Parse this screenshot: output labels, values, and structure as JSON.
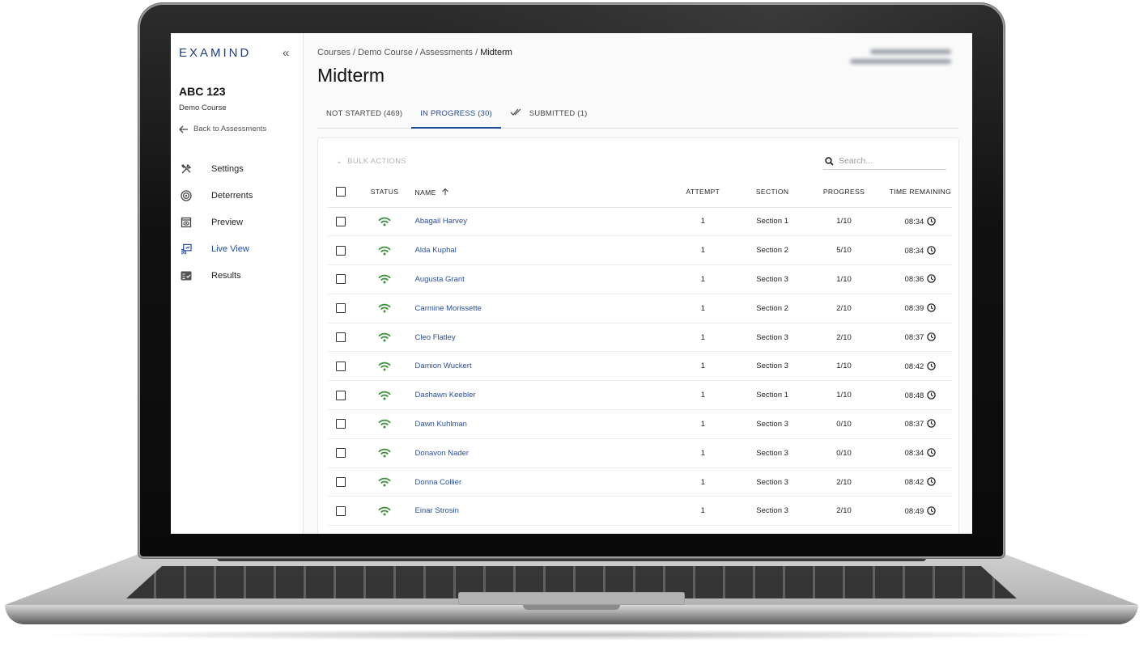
{
  "brand": {
    "logo_text": "EXAMIND",
    "accent": "#1f4a9a",
    "status_ok": "#3a8f3a"
  },
  "sidebar": {
    "collapse_icon": "double-chevron-left-icon",
    "course_code": "ABC 123",
    "course_name": "Demo Course",
    "back_label": "Back to Assessments",
    "items": [
      {
        "label": "Settings",
        "icon": "tools-icon",
        "active": false
      },
      {
        "label": "Deterrents",
        "icon": "target-icon",
        "active": false
      },
      {
        "label": "Preview",
        "icon": "preview-eye-icon",
        "active": false
      },
      {
        "label": "Live View",
        "icon": "live-cast-icon",
        "active": true
      },
      {
        "label": "Results",
        "icon": "results-list-icon",
        "active": false
      }
    ]
  },
  "header": {
    "breadcrumb": [
      "Courses",
      "Demo Course",
      "Assessments",
      "Midterm"
    ],
    "title": "Midterm"
  },
  "tabs": [
    {
      "label": "NOT STARTED (469)",
      "active": false
    },
    {
      "label": "IN PROGRESS (30)",
      "active": true
    },
    {
      "label": "SUBMITTED (1)",
      "active": false,
      "icon": "double-check-icon"
    }
  ],
  "toolbar": {
    "bulk_actions": "BULK ACTIONS",
    "search_placeholder": "Search..."
  },
  "table": {
    "columns": {
      "status": "STATUS",
      "name": "NAME",
      "attempt": "ATTEMPT",
      "section": "SECTION",
      "progress": "PROGRESS",
      "time_remaining": "TIME REMAINING"
    },
    "rows": [
      {
        "name": "Abagail Harvey",
        "attempt": "1",
        "section": "Section 1",
        "progress": "1/10",
        "time": "08:34"
      },
      {
        "name": "Alda Kuphal",
        "attempt": "1",
        "section": "Section 2",
        "progress": "5/10",
        "time": "08:34"
      },
      {
        "name": "Augusta Grant",
        "attempt": "1",
        "section": "Section 3",
        "progress": "1/10",
        "time": "08:36"
      },
      {
        "name": "Carmine Morissette",
        "attempt": "1",
        "section": "Section 2",
        "progress": "2/10",
        "time": "08:39"
      },
      {
        "name": "Cleo Flatley",
        "attempt": "1",
        "section": "Section 3",
        "progress": "2/10",
        "time": "08:37"
      },
      {
        "name": "Damion Wuckert",
        "attempt": "1",
        "section": "Section 3",
        "progress": "1/10",
        "time": "08:42"
      },
      {
        "name": "Dashawn Keebler",
        "attempt": "1",
        "section": "Section 1",
        "progress": "1/10",
        "time": "08:48"
      },
      {
        "name": "Dawn Kuhlman",
        "attempt": "1",
        "section": "Section 3",
        "progress": "0/10",
        "time": "08:37"
      },
      {
        "name": "Donavon Nader",
        "attempt": "1",
        "section": "Section 3",
        "progress": "0/10",
        "time": "08:34"
      },
      {
        "name": "Donna Collier",
        "attempt": "1",
        "section": "Section 3",
        "progress": "2/10",
        "time": "08:42"
      },
      {
        "name": "Einar Strosin",
        "attempt": "1",
        "section": "Section 3",
        "progress": "2/10",
        "time": "08:49"
      }
    ]
  }
}
